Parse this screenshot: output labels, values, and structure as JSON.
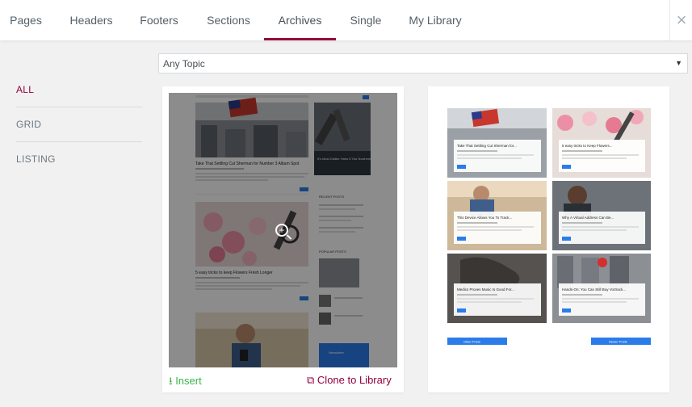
{
  "tabs": [
    {
      "label": "Pages"
    },
    {
      "label": "Headers"
    },
    {
      "label": "Footers"
    },
    {
      "label": "Sections"
    },
    {
      "label": "Archives"
    },
    {
      "label": "Single"
    },
    {
      "label": "My Library"
    }
  ],
  "active_tab": "Archives",
  "close_icon": "×",
  "topic_select": {
    "value": "Any Topic",
    "arrow": "▼"
  },
  "sidebar": {
    "items": [
      {
        "label": "ALL"
      },
      {
        "label": "GRID"
      },
      {
        "label": "LISTING"
      }
    ],
    "active": "ALL"
  },
  "card1": {
    "insert_label": "Insert",
    "clone_label": "Clone to Library",
    "insert_icon": "download-icon",
    "clone_icon": "copy-icon",
    "preview": {
      "post1_title": "Take That Settling Cut Sherman for Number 3 Album Spot",
      "post2_title": "5 easy tricks to keep Flowers Fresh Longer",
      "side_title": "It's Most Dislike Hairs 6 You Nowhere: The Weekend",
      "recent_label": "RECENT POSTS",
      "popular_label": "POPULAR POSTS",
      "newsletter_label": "Newsletter"
    }
  },
  "card2": {
    "preview": {
      "posts": [
        {
          "title": "Take That Settling Cut Sherman for..."
        },
        {
          "title": "5 easy tricks to Keep Flowers..."
        },
        {
          "title": "This Device Allows You To Track..."
        },
        {
          "title": "Why A Virtual Address Can Be..."
        },
        {
          "title": "Medics Proves Music Is Good For..."
        },
        {
          "title": "Hands-On: You Can Still Buy Vortrack..."
        }
      ],
      "prev_label": "Older Posts",
      "next_label": "Newer Posts"
    }
  },
  "colors": {
    "accent": "#93003c",
    "insert": "#39b54a",
    "blue": "#2b7ce9"
  }
}
